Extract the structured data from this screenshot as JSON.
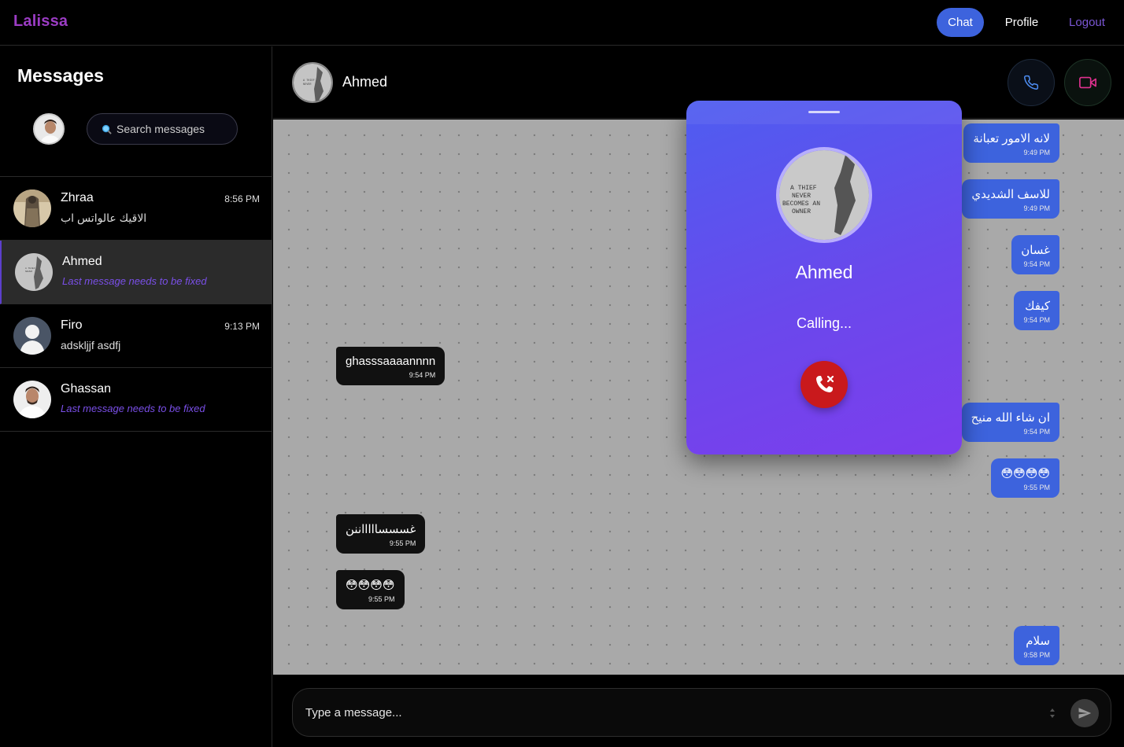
{
  "nav": {
    "brand": "Lalissa",
    "chat_label": "Chat",
    "profile_label": "Profile",
    "logout_label": "Logout",
    "brand_color": "#9b3cc4",
    "accent_color": "#3d63dd"
  },
  "sidebar": {
    "title": "Messages",
    "search_placeholder": "Search messages",
    "contacts": [
      {
        "name": "Zhraa",
        "time": "8:56 PM",
        "last_message": "الاقيك عالواتس اب",
        "active": false
      },
      {
        "name": "Ahmed",
        "time": "",
        "last_message": "Last message needs to be fixed",
        "active": true
      },
      {
        "name": "Firo",
        "time": "9:13 PM",
        "last_message": "adskljjf asdfj",
        "active": false
      },
      {
        "name": "Ghassan",
        "time": "",
        "last_message": "Last message needs to be fixed",
        "active": false
      }
    ]
  },
  "chat": {
    "contact_name": "Ahmed",
    "messages": [
      {
        "direction": "out",
        "text": "لانه الامور تعبانة",
        "time": "9:49 PM"
      },
      {
        "direction": "out",
        "text": "للاسف الشديدي",
        "time": "9:49 PM"
      },
      {
        "direction": "out",
        "text": "غسان",
        "time": "9:54 PM"
      },
      {
        "direction": "out",
        "text": "كيفك",
        "time": "9:54 PM"
      },
      {
        "direction": "in",
        "text": "ghasssaaaannnn",
        "time": "9:54 PM"
      },
      {
        "direction": "out",
        "text": "ان شاء الله منيح",
        "time": "9:54 PM"
      },
      {
        "direction": "out",
        "text": "😳😳😳😳",
        "time": "9:55 PM"
      },
      {
        "direction": "in",
        "text": "غسسساااااننن",
        "time": "9:55 PM"
      },
      {
        "direction": "in",
        "text": "😳😳😳😳",
        "time": "9:55 PM"
      },
      {
        "direction": "out",
        "text": "سلام",
        "time": "9:58 PM"
      }
    ],
    "composer_placeholder": "Type a message..."
  },
  "call": {
    "name": "Ahmed",
    "status": "Calling...",
    "avatar_caption": "A THIEF NEVER BECOMES AN OWNER",
    "end_color": "#c9191c"
  }
}
